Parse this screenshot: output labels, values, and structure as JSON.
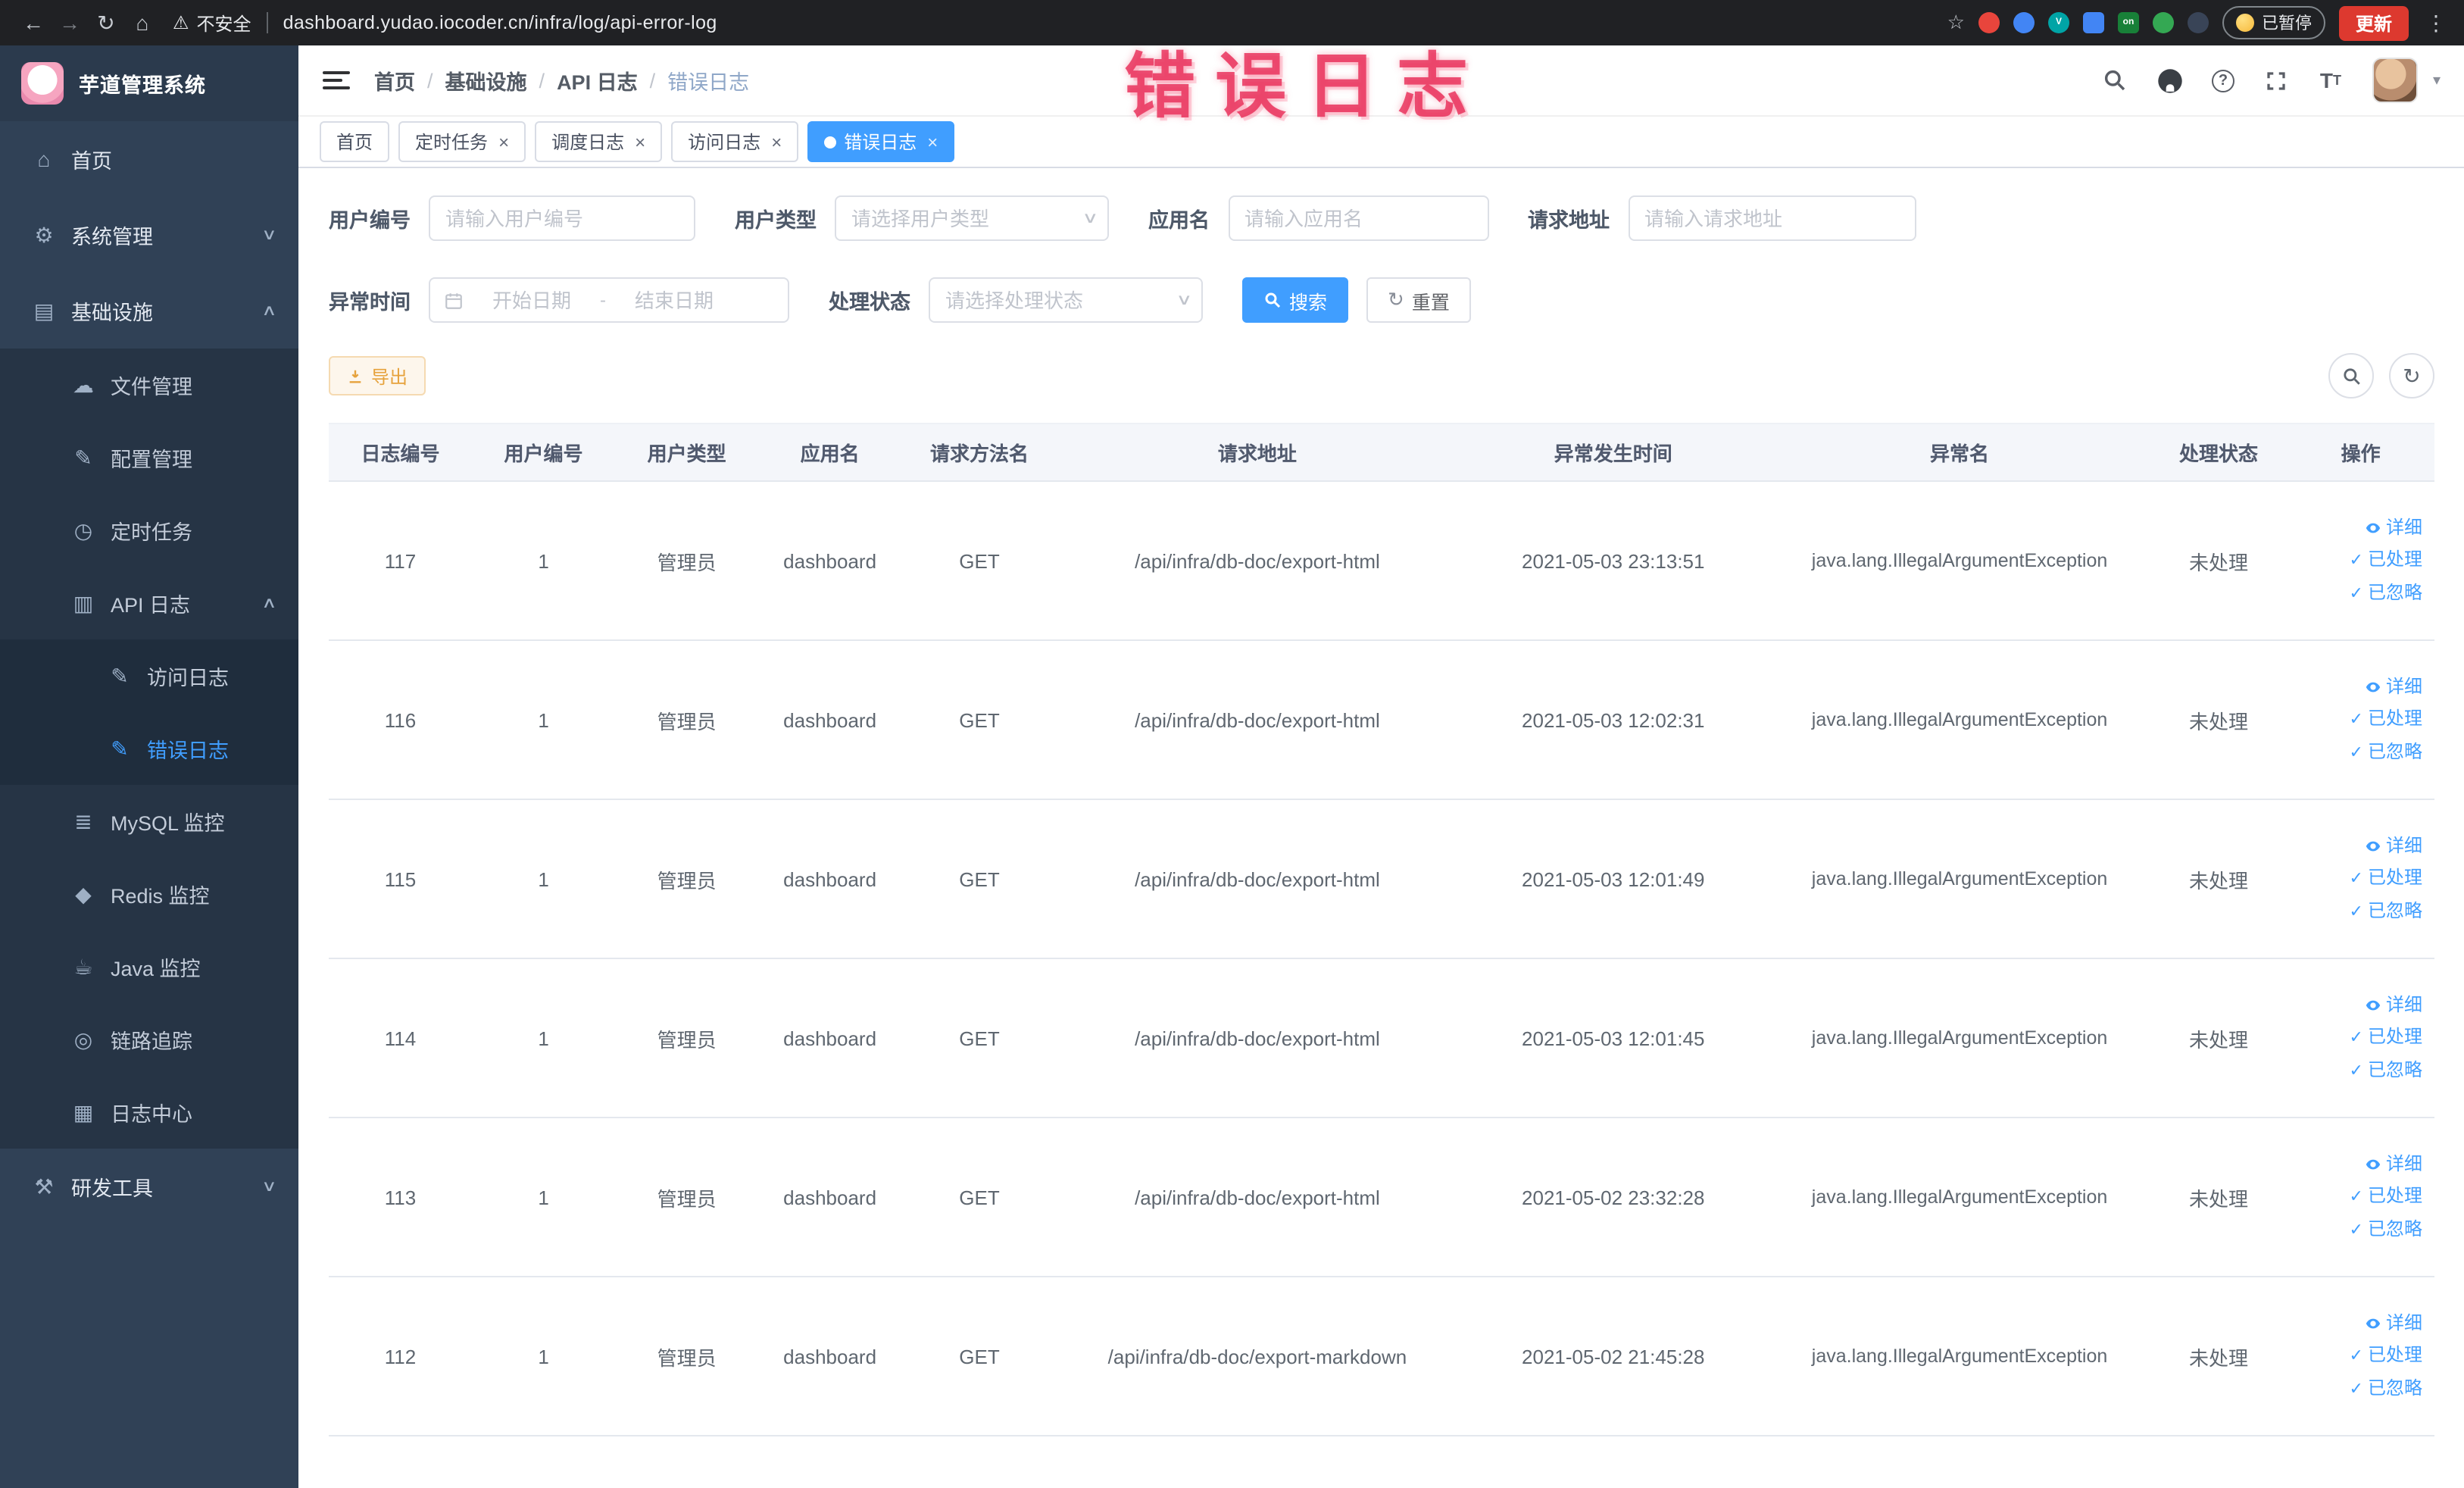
{
  "browser": {
    "security_text": "不安全",
    "url": "dashboard.yudao.iocoder.cn/infra/log/api-error-log",
    "vpn_badge": "on",
    "paused_badge": "已暂停",
    "update_button": "更新"
  },
  "overlay": {
    "text": "错误日志"
  },
  "sidebar": {
    "logo_title": "芋道管理系统",
    "items": [
      {
        "label": "首页"
      },
      {
        "label": "系统管理"
      },
      {
        "label": "基础设施"
      },
      {
        "label": "文件管理"
      },
      {
        "label": "配置管理"
      },
      {
        "label": "定时任务"
      },
      {
        "label": "API 日志"
      },
      {
        "label": "访问日志"
      },
      {
        "label": "错误日志"
      },
      {
        "label": "MySQL 监控"
      },
      {
        "label": "Redis 监控"
      },
      {
        "label": "Java 监控"
      },
      {
        "label": "链路追踪"
      },
      {
        "label": "日志中心"
      },
      {
        "label": "研发工具"
      }
    ]
  },
  "breadcrumb": {
    "items": [
      "首页",
      "基础设施",
      "API 日志",
      "错误日志"
    ]
  },
  "tabs": [
    {
      "label": "首页"
    },
    {
      "label": "定时任务"
    },
    {
      "label": "调度日志"
    },
    {
      "label": "访问日志"
    },
    {
      "label": "错误日志"
    }
  ],
  "filters": {
    "user_id_label": "用户编号",
    "user_id_placeholder": "请输入用户编号",
    "user_type_label": "用户类型",
    "user_type_placeholder": "请选择用户类型",
    "app_name_label": "应用名",
    "app_name_placeholder": "请输入应用名",
    "request_url_label": "请求地址",
    "request_url_placeholder": "请输入请求地址",
    "exception_time_label": "异常时间",
    "start_date_placeholder": "开始日期",
    "range_separator": "-",
    "end_date_placeholder": "结束日期",
    "process_status_label": "处理状态",
    "process_status_placeholder": "请选择处理状态",
    "search_button": "搜索",
    "reset_button": "重置"
  },
  "toolbar": {
    "export_button": "导出"
  },
  "table": {
    "columns": [
      "日志编号",
      "用户编号",
      "用户类型",
      "应用名",
      "请求方法名",
      "请求地址",
      "异常发生时间",
      "异常名",
      "处理状态",
      "操作"
    ],
    "actions": [
      "详细",
      "已处理",
      "已忽略"
    ],
    "rows": [
      {
        "log_id": "117",
        "user_id": "1",
        "user_type": "管理员",
        "app_name": "dashboard",
        "method": "GET",
        "url": "/api/infra/db-doc/export-html",
        "time": "2021-05-03 23:13:51",
        "exception": "java.lang.IllegalArgumentException",
        "status": "未处理"
      },
      {
        "log_id": "116",
        "user_id": "1",
        "user_type": "管理员",
        "app_name": "dashboard",
        "method": "GET",
        "url": "/api/infra/db-doc/export-html",
        "time": "2021-05-03 12:02:31",
        "exception": "java.lang.IllegalArgumentException",
        "status": "未处理"
      },
      {
        "log_id": "115",
        "user_id": "1",
        "user_type": "管理员",
        "app_name": "dashboard",
        "method": "GET",
        "url": "/api/infra/db-doc/export-html",
        "time": "2021-05-03 12:01:49",
        "exception": "java.lang.IllegalArgumentException",
        "status": "未处理"
      },
      {
        "log_id": "114",
        "user_id": "1",
        "user_type": "管理员",
        "app_name": "dashboard",
        "method": "GET",
        "url": "/api/infra/db-doc/export-html",
        "time": "2021-05-03 12:01:45",
        "exception": "java.lang.IllegalArgumentException",
        "status": "未处理"
      },
      {
        "log_id": "113",
        "user_id": "1",
        "user_type": "管理员",
        "app_name": "dashboard",
        "method": "GET",
        "url": "/api/infra/db-doc/export-html",
        "time": "2021-05-02 23:32:28",
        "exception": "java.lang.IllegalArgumentException",
        "status": "未处理"
      },
      {
        "log_id": "112",
        "user_id": "1",
        "user_type": "管理员",
        "app_name": "dashboard",
        "method": "GET",
        "url": "/api/infra/db-doc/export-markdown",
        "time": "2021-05-02 21:45:28",
        "exception": "java.lang.IllegalArgumentException",
        "status": "未处理"
      }
    ]
  },
  "colors": {
    "accent": "#409eff",
    "warning": "#e6a23c",
    "overlay_red": "#e8305a",
    "sidebar_bg": "#304156",
    "submenu_bg": "#263445",
    "update_red": "#dd392f"
  }
}
